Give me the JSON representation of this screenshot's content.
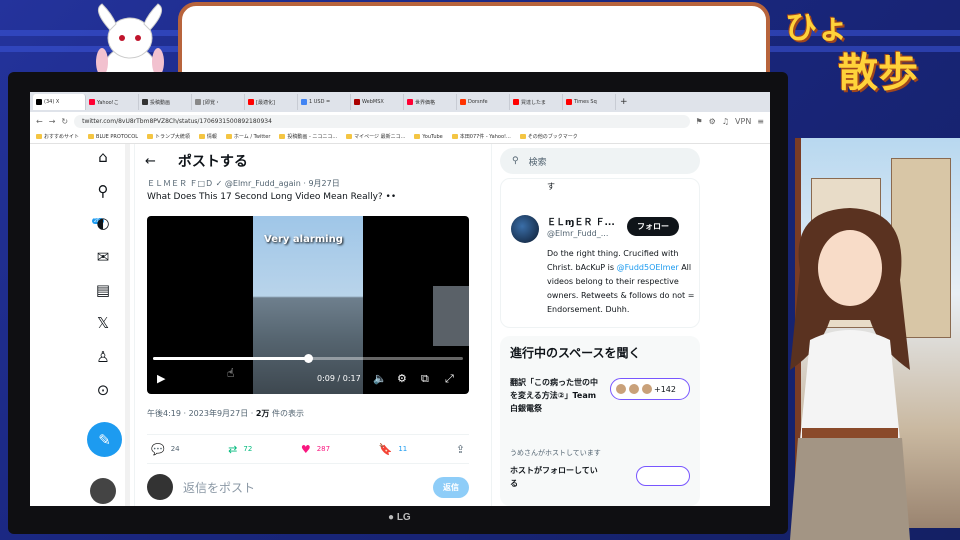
{
  "stream": {
    "title_line1": "ひょ",
    "title_line2": "散歩",
    "colors": {
      "bg": "#1c2a8c",
      "title": "#ffd23a",
      "speech_border": "#b8643c"
    }
  },
  "browser": {
    "tabs": [
      {
        "label": "(34) X",
        "color": "#000000"
      },
      {
        "label": "Yahoo!こ",
        "color": "#ff0033"
      },
      {
        "label": "投稿動画",
        "color": "#333333"
      },
      {
        "label": "[即覚・",
        "color": "#888888"
      },
      {
        "label": "[最適化]",
        "color": "#ff0000"
      },
      {
        "label": "1 USD =",
        "color": "#4285f4"
      },
      {
        "label": "WebMSX",
        "color": "#aa0000"
      },
      {
        "label": "世界価格",
        "color": "#ff0033"
      },
      {
        "label": "Dorsnfe",
        "color": "#ff3300"
      },
      {
        "label": "買達したま",
        "color": "#ff0000"
      },
      {
        "label": "Times Sq",
        "color": "#ff0000"
      }
    ],
    "url": "twitter.com/8vU8rTbm8PVZ8Ch/status/1706931500892180934",
    "vpn_label": "VPN",
    "bookmarks": [
      "おすすめサイト",
      "BLUE PROTOCOL",
      "トランプ大統領",
      "情報",
      "ホーム / Twitter",
      "投稿動画 - ニコニコ...",
      "マイページ 最新ニコ...",
      "YouTube",
      "本田077件 - Yahoo!...",
      "その他のブックマーク"
    ]
  },
  "twitter": {
    "nav_badge": "20+",
    "header": {
      "title": "ポストする"
    },
    "quote": {
      "author": "ＥＬＭＥＲ Ｆ□Ｄ ✓",
      "meta": "@Elmr_Fudd_again · 9月27日",
      "text": "What Does This 17 Second Long Video Mean Really? ••"
    },
    "video": {
      "caption": "Very alarming",
      "time": "0:09 / 0:17",
      "progress": 0.5
    },
    "timestamp": {
      "prefix": "午後4:19 · 2023年9月27日 · ",
      "views": "2万",
      "suffix": " 件の表示"
    },
    "actions": {
      "replies": "24",
      "reposts": "72",
      "likes": "287",
      "bookmarks": "11"
    },
    "reply": {
      "placeholder": "返信をポスト",
      "button": "返信"
    },
    "search_placeholder": "検索",
    "profile": {
      "top_text": "す",
      "name": "ＥＬɱＥＲ Ｆ...",
      "handle": "@Elmr_Fudd_...",
      "follow": "フォロー",
      "bio_1": "Do the right thing. Crucified with Christ. bAcKuP is",
      "bio_link": "@Fudd5OElmer",
      "bio_2": "All videos belong to their respective owners. Retweets & follows do not = Endorsement. Duhh."
    },
    "spaces": {
      "title": "進行中のスペースを聞く",
      "item1": "翻訳「この病った世の中を変える方法②」Team白銀電祭",
      "item1_count": "+142",
      "host_line": "うめさんがホストしています",
      "item2": "ホストがフォローしている"
    }
  }
}
